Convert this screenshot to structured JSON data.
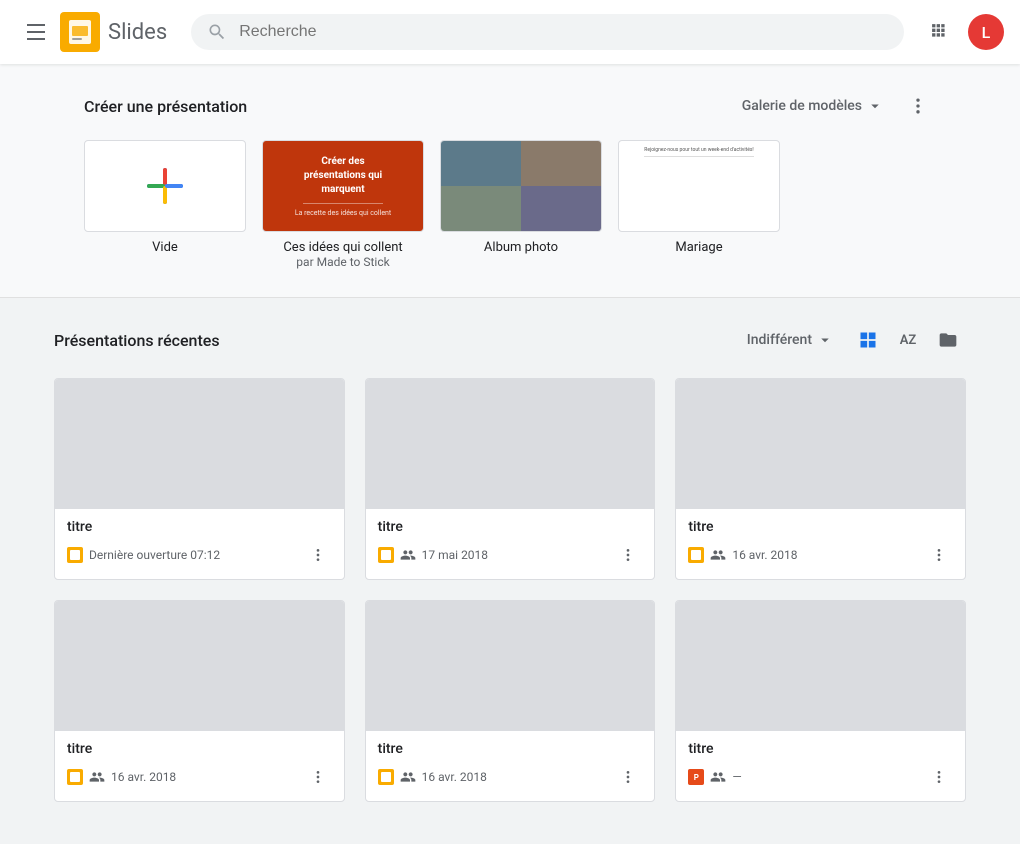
{
  "header": {
    "app_name": "Slides",
    "search_placeholder": "Recherche",
    "avatar_letter": "L",
    "avatar_color": "#e53935"
  },
  "template_section": {
    "title": "Créer une présentation",
    "gallery_label": "Galerie de modèles",
    "templates": [
      {
        "id": "blank",
        "label": "Vide",
        "sublabel": ""
      },
      {
        "id": "made-to-stick",
        "label": "Ces idées qui collent",
        "sublabel": "par Made to Stick"
      },
      {
        "id": "album-photo",
        "label": "Album photo",
        "sublabel": ""
      },
      {
        "id": "mariage",
        "label": "Mariage",
        "sublabel": ""
      }
    ]
  },
  "recent_section": {
    "title": "Présentations récentes",
    "filter_label": "Indifférent",
    "presentations": [
      {
        "id": 1,
        "title": "titre",
        "meta": "Dernière ouverture 07:12",
        "icon": "slides",
        "shared": false,
        "has_people": false,
        "row": 1
      },
      {
        "id": 2,
        "title": "titre",
        "meta": "17 mai 2018",
        "icon": "slides",
        "shared": true,
        "row": 1
      },
      {
        "id": 3,
        "title": "titre",
        "meta": "16 avr. 2018",
        "icon": "slides",
        "shared": true,
        "row": 1
      },
      {
        "id": 4,
        "title": "titre",
        "meta": "16 avr. 2018",
        "icon": "slides",
        "shared": true,
        "row": 2
      },
      {
        "id": 5,
        "title": "titre",
        "meta": "16 avr. 2018",
        "icon": "slides",
        "shared": true,
        "row": 2
      },
      {
        "id": 6,
        "title": "titre",
        "meta": "—",
        "icon": "ppt",
        "shared": true,
        "row": 2
      }
    ]
  }
}
